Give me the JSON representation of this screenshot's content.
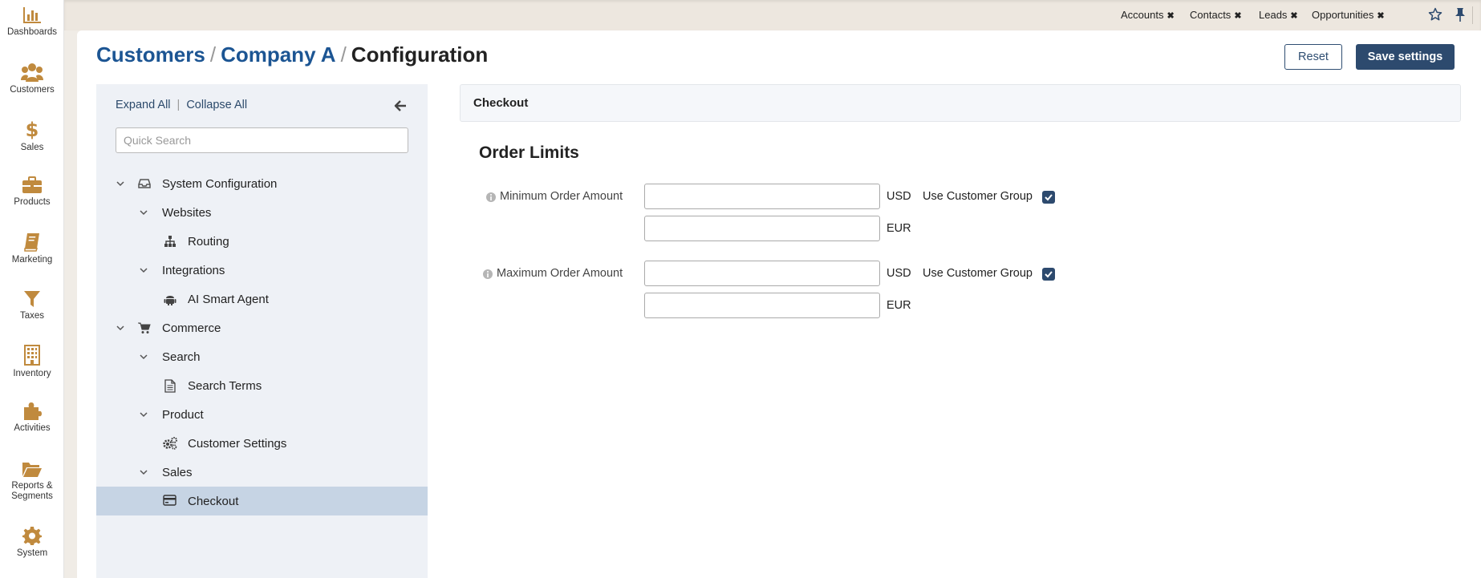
{
  "nav": {
    "items": [
      {
        "label": "Dashboards",
        "icon": "dashboards-icon"
      },
      {
        "label": "Customers",
        "icon": "customers-icon"
      },
      {
        "label": "Sales",
        "icon": "dollar-icon"
      },
      {
        "label": "Products",
        "icon": "briefcase-icon"
      },
      {
        "label": "Marketing",
        "icon": "book-icon"
      },
      {
        "label": "Taxes",
        "icon": "funnel-icon"
      },
      {
        "label": "Inventory",
        "icon": "building-icon"
      },
      {
        "label": "Activities",
        "icon": "puzzle-icon"
      },
      {
        "label": "Reports &",
        "label2": "Segments",
        "icon": "folder-icon"
      },
      {
        "label": "System",
        "icon": "gear-icon"
      }
    ],
    "icon_color": "#c08a3e"
  },
  "topbar": {
    "shortcuts": [
      "Accounts",
      "Contacts",
      "Leads",
      "Opportunities"
    ],
    "close_glyph": "✖"
  },
  "breadcrumb": {
    "items": [
      "Customers",
      "Company A"
    ],
    "separator": "/",
    "current": "Configuration"
  },
  "buttons": {
    "reset": "Reset",
    "save": "Save settings"
  },
  "tree": {
    "expand_all": "Expand All",
    "collapse_all": "Collapse All",
    "search_placeholder": "Quick Search",
    "nodes": {
      "system_configuration": "System Configuration",
      "websites": "Websites",
      "routing": "Routing",
      "integrations": "Integrations",
      "ai_smart_agent": "AI Smart Agent",
      "commerce": "Commerce",
      "search": "Search",
      "search_terms": "Search Terms",
      "product": "Product",
      "customer_settings": "Customer Settings",
      "sales": "Sales",
      "checkout": "Checkout"
    },
    "active": "Checkout"
  },
  "content": {
    "header": "Checkout",
    "section_title": "Order Limits",
    "min_label": "Minimum Order Amount",
    "max_label": "Maximum Order Amount",
    "currency_usd": "USD",
    "currency_eur": "EUR",
    "use_customer_group": "Use Customer Group",
    "min_usd_value": "",
    "min_eur_value": "",
    "max_usd_value": "",
    "max_eur_value": "",
    "min_use_group_checked": true,
    "max_use_group_checked": true
  },
  "colors": {
    "brand_blue": "#2d4a6e",
    "link_blue": "#1c5593",
    "active_row": "#c6d4e4"
  }
}
